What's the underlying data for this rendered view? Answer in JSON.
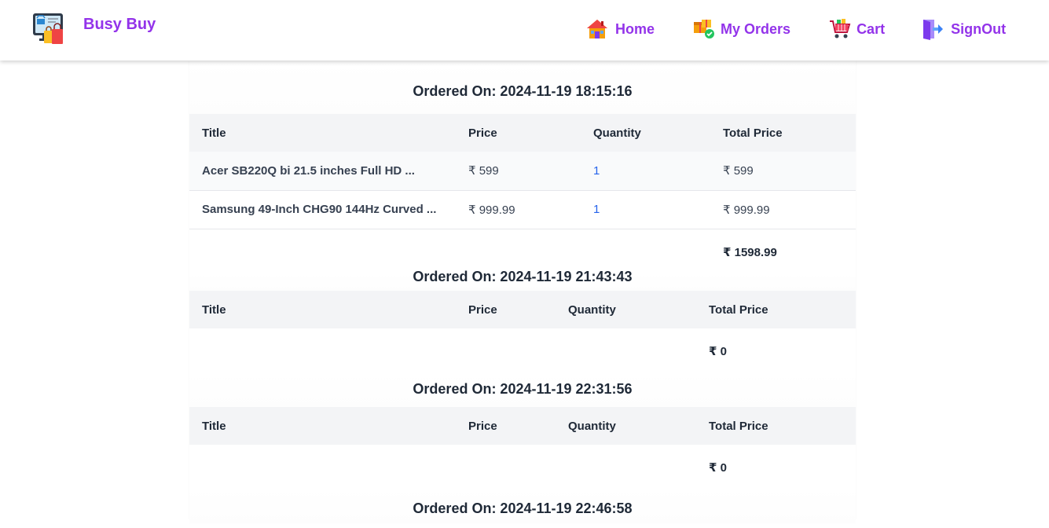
{
  "header": {
    "brand": "Busy Buy",
    "nav": [
      {
        "label": "Home",
        "icon": "house-icon"
      },
      {
        "label": "My Orders",
        "icon": "orders-box-icon"
      },
      {
        "label": "Cart",
        "icon": "cart-icon"
      },
      {
        "label": "SignOut",
        "icon": "signout-door-icon"
      }
    ]
  },
  "columns": [
    "Title",
    "Price",
    "Quantity",
    "Total Price"
  ],
  "orders": [
    {
      "heading": "Ordered On: 2024-11-19 18:15:16",
      "items": [
        {
          "title": "Acer SB220Q bi 21.5 inches Full HD ...",
          "price": "₹ 599",
          "quantity": "1",
          "total": "₹ 599"
        },
        {
          "title": "Samsung 49-Inch CHG90 144Hz Curved ...",
          "price": "₹ 999.99",
          "quantity": "1",
          "total": "₹ 999.99"
        }
      ],
      "grand_total": "₹ 1598.99"
    },
    {
      "heading": "Ordered On: 2024-11-19 21:43:43",
      "items": [],
      "grand_total": "₹ 0"
    },
    {
      "heading": "Ordered On: 2024-11-19 22:31:56",
      "items": [],
      "grand_total": "₹ 0"
    },
    {
      "heading": "Ordered On: 2024-11-19 22:46:58",
      "items": [],
      "grand_total": ""
    }
  ],
  "colors": {
    "accent": "#9333ea",
    "quantity": "#2563eb",
    "header_bg": "#f3f4f6"
  }
}
